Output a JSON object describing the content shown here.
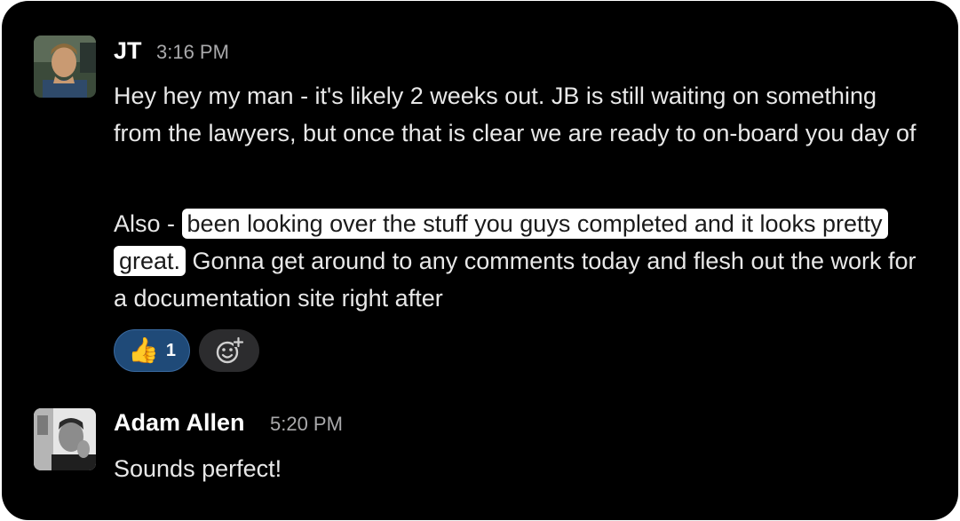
{
  "messages": [
    {
      "author": "JT",
      "time": "3:16 PM",
      "paragraph1": "Hey hey my man - it's likely 2 weeks out. JB is still waiting on something from the lawyers, but once that is clear we are ready to on-board you day of",
      "paragraph2_pre": "Also - ",
      "paragraph2_highlight": "been looking over the stuff you guys completed and it looks pretty great.",
      "paragraph2_post": " Gonna get around to any comments today and flesh out the work for a documentation site right after",
      "reactions": [
        {
          "emoji": "👍",
          "icon": "thumbs-up-icon",
          "count": "1"
        }
      ],
      "add_reaction_icon": "add-reaction-icon"
    },
    {
      "author": "Adam Allen",
      "time": "5:20 PM",
      "text": "Sounds perfect!"
    }
  ],
  "colors": {
    "background": "#000000",
    "highlight": "#ffffff",
    "reaction_bg": "#1f4a78",
    "timestamp": "#a9a9ab"
  }
}
